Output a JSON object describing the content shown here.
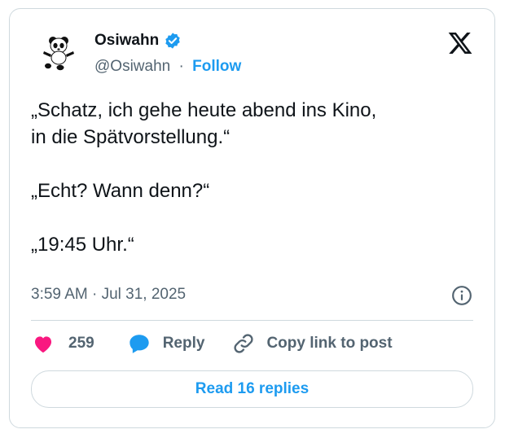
{
  "author": {
    "display_name": "Osiwahn",
    "handle": "@Osiwahn",
    "verified": true,
    "follow_label": "Follow",
    "separator": "·"
  },
  "tweet": {
    "lines": [
      "„Schatz, ich gehe heute abend ins Kino,",
      "in die Spätvorstellung.“",
      "„Echt? Wann denn?“",
      "„19:45 Uhr.“"
    ],
    "timestamp": "3:59 AM · Jul 31, 2025"
  },
  "actions": {
    "like_count": "259",
    "reply_label": "Reply",
    "copy_link_label": "Copy link to post"
  },
  "read_replies_label": "Read 16 replies",
  "icons": {
    "avatar": "panda-avatar",
    "verified": "verified-badge-icon",
    "platform": "x-logo-icon",
    "info": "info-icon",
    "like": "heart-icon",
    "reply": "reply-bubble-icon",
    "copy": "link-icon"
  },
  "colors": {
    "accent": "#1d9bf0",
    "like": "#f91880",
    "text": "#0f1419",
    "muted": "#536471",
    "border": "#cfd9de"
  }
}
